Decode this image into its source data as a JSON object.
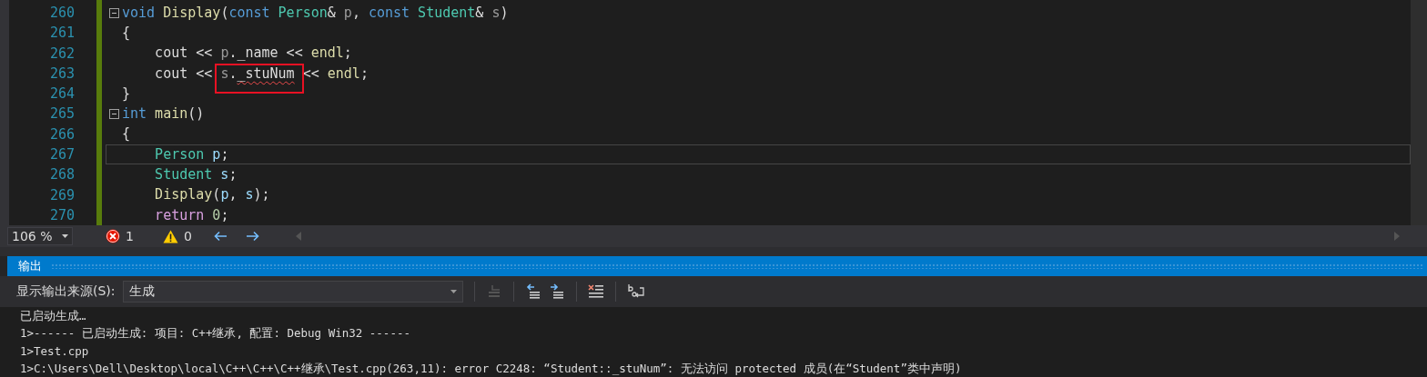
{
  "editor": {
    "lines": [
      {
        "number": "260",
        "foldable": true,
        "current": false,
        "tokens": [
          {
            "kind": "keyword",
            "text": "void"
          },
          {
            "kind": "func",
            "text": " Display"
          },
          {
            "kind": "plain",
            "text": "("
          },
          {
            "kind": "keyword",
            "text": "const"
          },
          {
            "kind": "type",
            "text": " Person"
          },
          {
            "kind": "plain",
            "text": "& "
          },
          {
            "kind": "param",
            "text": "p"
          },
          {
            "kind": "plain",
            "text": ", "
          },
          {
            "kind": "keyword",
            "text": "const"
          },
          {
            "kind": "type",
            "text": " Student"
          },
          {
            "kind": "plain",
            "text": "& "
          },
          {
            "kind": "param",
            "text": "s"
          },
          {
            "kind": "plain",
            "text": ")"
          }
        ]
      },
      {
        "number": "261",
        "foldable": false,
        "current": false,
        "tokens": [
          {
            "kind": "plain",
            "text": "{"
          }
        ]
      },
      {
        "number": "262",
        "foldable": false,
        "current": false,
        "tokens": [
          {
            "kind": "plain",
            "text": "    cout << "
          },
          {
            "kind": "param",
            "text": "p"
          },
          {
            "kind": "plain",
            "text": "._name << "
          },
          {
            "kind": "func",
            "text": "endl"
          },
          {
            "kind": "plain",
            "text": ";"
          }
        ]
      },
      {
        "number": "263",
        "foldable": false,
        "current": false,
        "tokens": [
          {
            "kind": "plain",
            "text": "    cout << "
          },
          {
            "kind": "box",
            "tokens": [
              {
                "kind": "param",
                "text": "s"
              },
              {
                "kind": "plain",
                "text": "."
              },
              {
                "kind": "error",
                "text": "_stuNum"
              }
            ]
          },
          {
            "kind": "plain",
            "text": " << "
          },
          {
            "kind": "func",
            "text": "endl"
          },
          {
            "kind": "plain",
            "text": ";"
          }
        ]
      },
      {
        "number": "264",
        "foldable": false,
        "current": false,
        "tokens": [
          {
            "kind": "plain",
            "text": "}"
          }
        ]
      },
      {
        "number": "265",
        "foldable": true,
        "current": false,
        "tokens": [
          {
            "kind": "keyword",
            "text": "int"
          },
          {
            "kind": "func",
            "text": " main"
          },
          {
            "kind": "plain",
            "text": "()"
          }
        ]
      },
      {
        "number": "266",
        "foldable": false,
        "current": false,
        "tokens": [
          {
            "kind": "plain",
            "text": "{"
          }
        ]
      },
      {
        "number": "267",
        "foldable": false,
        "current": true,
        "tokens": [
          {
            "kind": "type",
            "text": "    Person"
          },
          {
            "kind": "local",
            "text": " p"
          },
          {
            "kind": "plain",
            "text": ";"
          }
        ]
      },
      {
        "number": "268",
        "foldable": false,
        "current": false,
        "tokens": [
          {
            "kind": "type",
            "text": "    Student"
          },
          {
            "kind": "local",
            "text": " s"
          },
          {
            "kind": "plain",
            "text": ";"
          }
        ]
      },
      {
        "number": "269",
        "foldable": false,
        "current": false,
        "tokens": [
          {
            "kind": "func",
            "text": "    Display"
          },
          {
            "kind": "plain",
            "text": "("
          },
          {
            "kind": "local",
            "text": "p"
          },
          {
            "kind": "plain",
            "text": ", "
          },
          {
            "kind": "local",
            "text": "s"
          },
          {
            "kind": "plain",
            "text": ");"
          }
        ]
      },
      {
        "number": "270",
        "foldable": false,
        "current": false,
        "tokens": [
          {
            "kind": "control",
            "text": "    return"
          },
          {
            "kind": "number",
            "text": " 0"
          },
          {
            "kind": "plain",
            "text": ";"
          }
        ]
      }
    ]
  },
  "status_strip": {
    "zoom": "106 %",
    "errors": "1",
    "warnings": "0"
  },
  "output": {
    "title": "输出",
    "source_label": "显示输出来源(S):",
    "source_value": "生成",
    "lines": [
      "已启动生成…",
      "1>------ 已启动生成: 项目: C++继承, 配置: Debug Win32 ------",
      "1>Test.cpp",
      "1>C:\\Users\\Dell\\Desktop\\local\\C++\\C++\\C++继承\\Test.cpp(263,11): error C2248: “Student::_stuNum”: 无法访问 protected 成员(在“Student”类中声明)"
    ]
  }
}
